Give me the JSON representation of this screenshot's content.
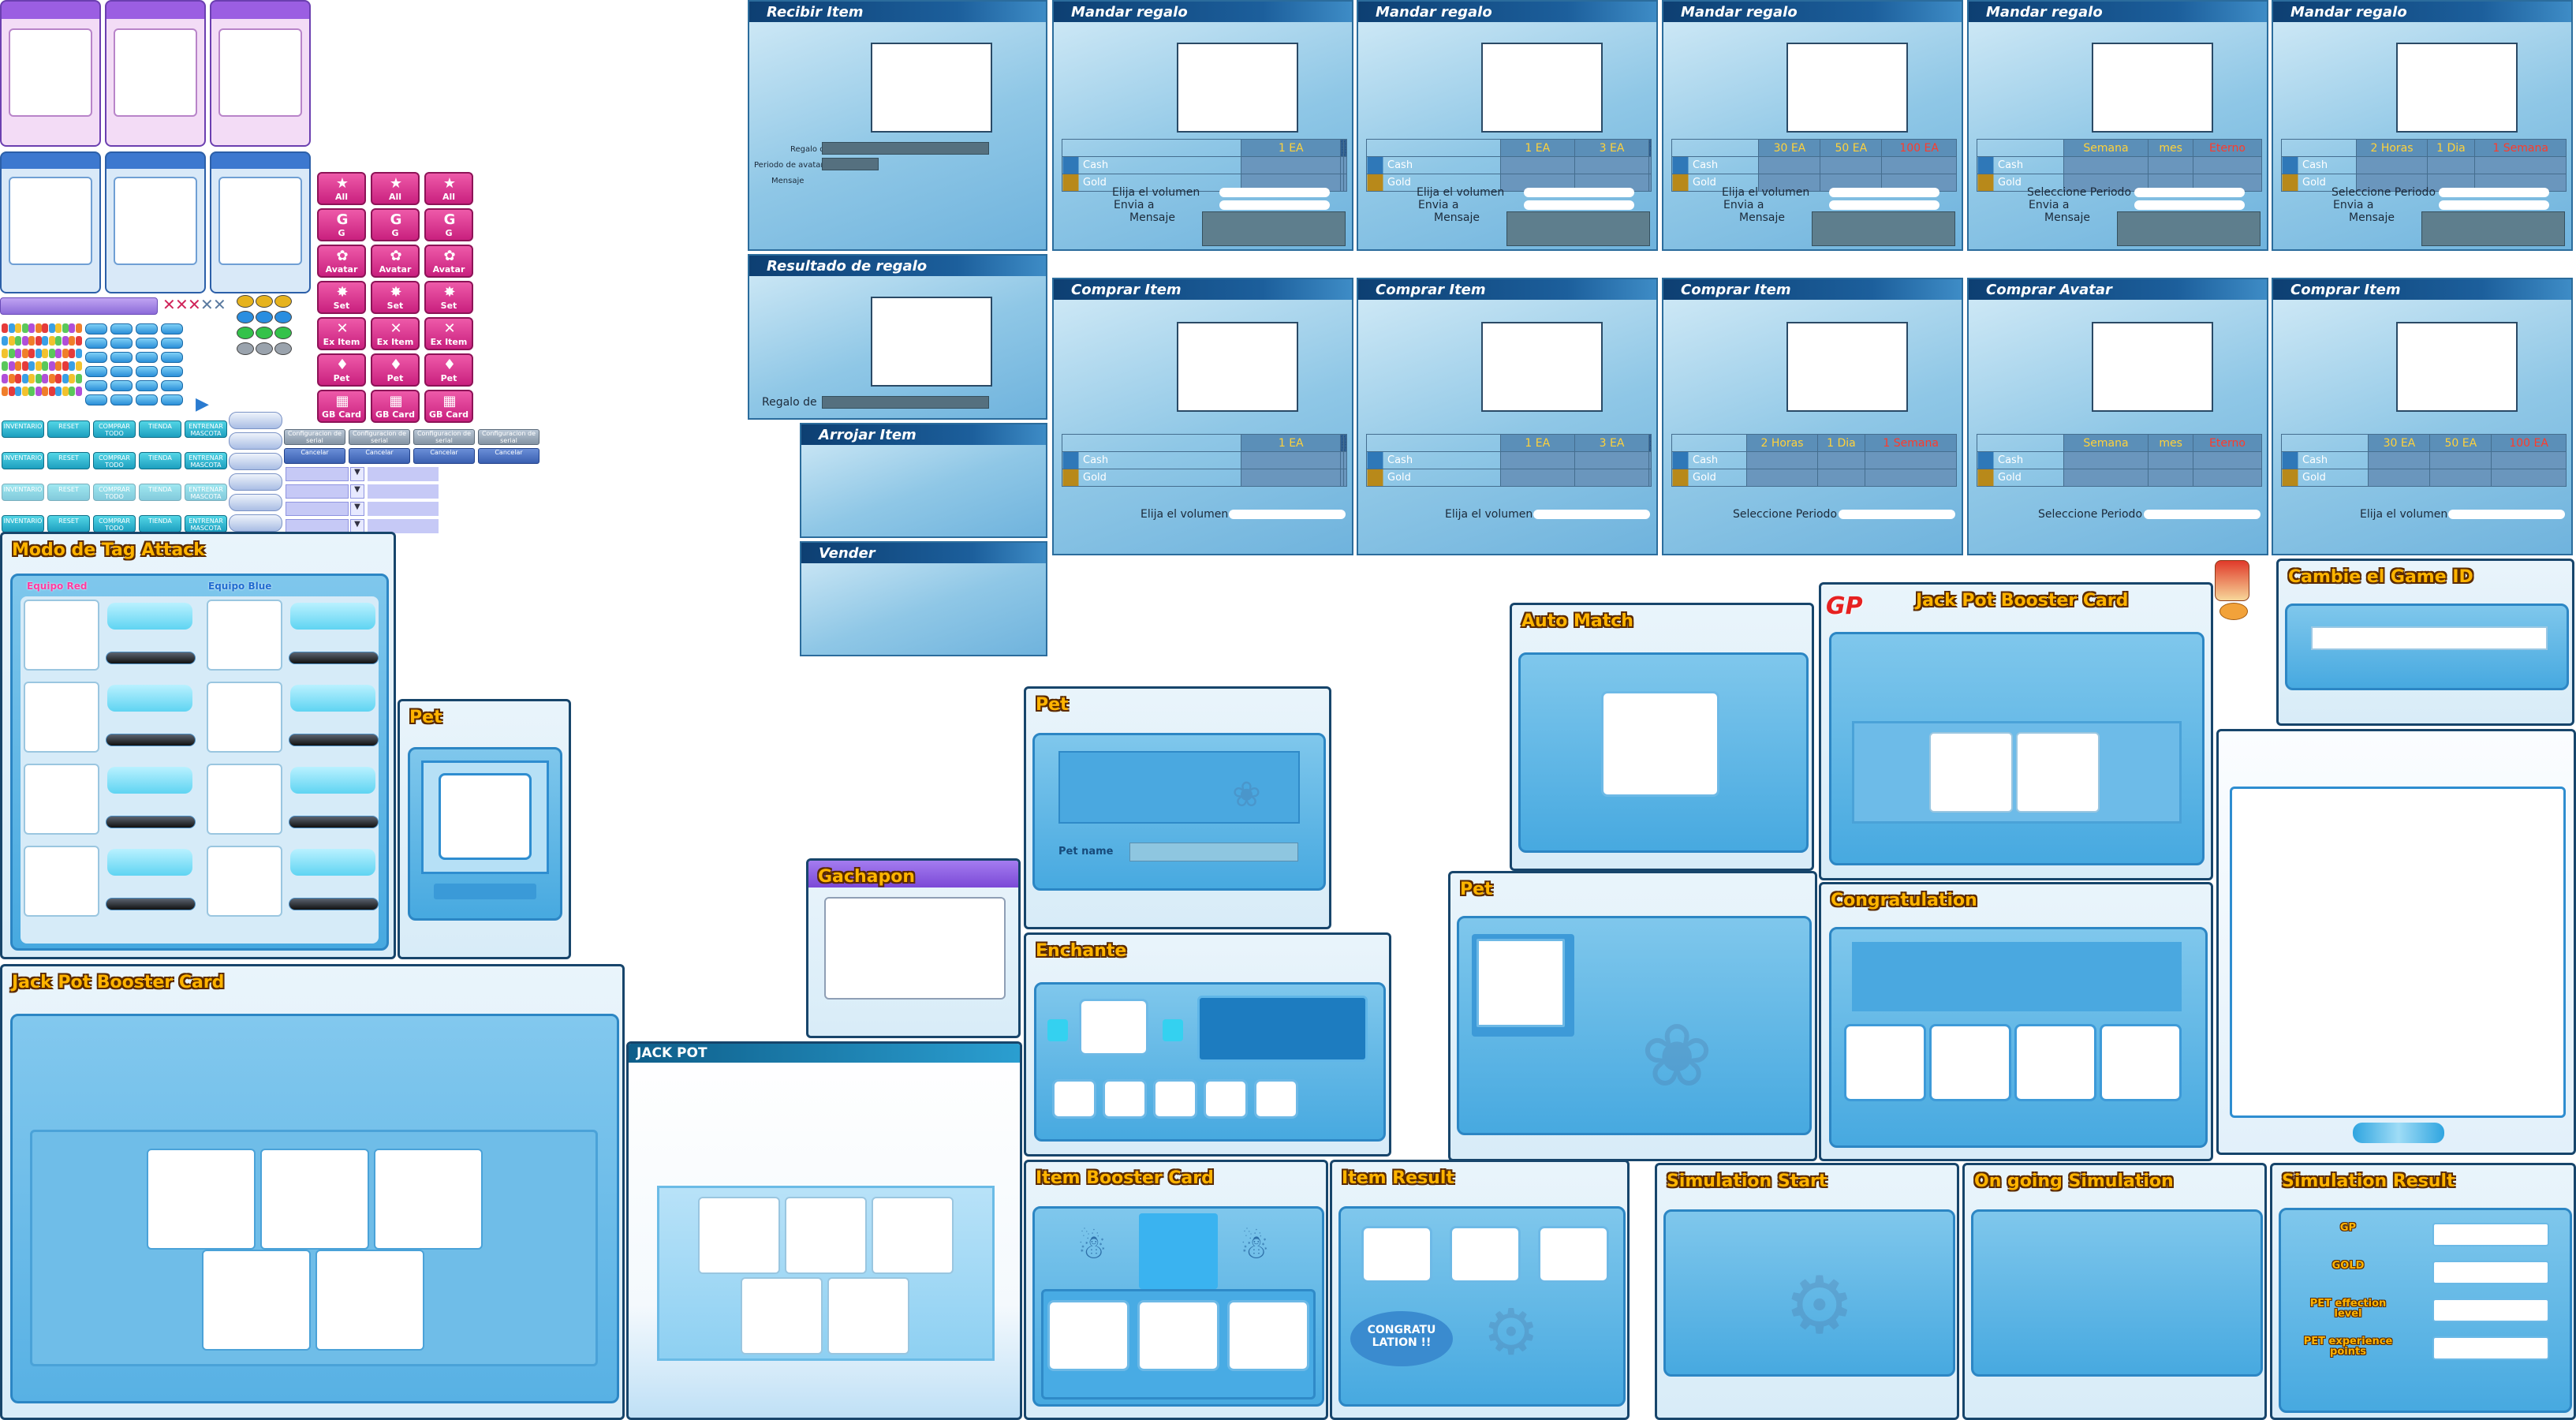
{
  "sprite": {
    "pink_buttons": [
      "All",
      "All",
      "All",
      "G",
      "G",
      "G",
      "Avatar",
      "Avatar",
      "Avatar",
      "Set",
      "Set",
      "Set",
      "Ex Item",
      "Ex Item",
      "Ex Item",
      "Pet",
      "Pet",
      "Pet",
      "GB Card",
      "GB Card",
      "GB Card"
    ],
    "tab_buttons": [
      "INVENTARIO",
      "RESET",
      "COMPRAR TODO",
      "TIENDA",
      "ENTRENAR MASCOTA"
    ],
    "gray_buttons": [
      "Configuracion de serial",
      "Cancelar"
    ],
    "colors": {
      "pink": "#d3308a",
      "blue": "#4aa7df",
      "purple": "#8b56d8"
    }
  },
  "gift_dialogs": [
    {
      "title": "Recibir Item",
      "labels": [
        "Regalo de",
        "Periodo de avatar",
        "Mensaje"
      ]
    },
    {
      "title": "Resultado de regalo",
      "labels": [
        "Regalo de"
      ]
    },
    {
      "title": "Arrojar Item"
    },
    {
      "title": "Vender"
    }
  ],
  "mandar": [
    {
      "title": "Mandar regalo",
      "cols": [
        "1 EA",
        "",
        ""
      ],
      "x": [
        false,
        true,
        true
      ],
      "red": [
        false,
        false,
        false
      ],
      "rows": [
        "Elija el volumen",
        "Envia a",
        "Mensaje"
      ]
    },
    {
      "title": "Mandar regalo",
      "cols": [
        "1 EA",
        "3 EA",
        ""
      ],
      "x": [
        false,
        false,
        true
      ],
      "red": [
        false,
        false,
        false
      ],
      "rows": [
        "Elija el volumen",
        "Envia a",
        "Mensaje"
      ]
    },
    {
      "title": "Mandar regalo",
      "cols": [
        "30 EA",
        "50 EA",
        "100 EA"
      ],
      "x": [
        false,
        false,
        false
      ],
      "red": [
        false,
        false,
        true
      ],
      "rows": [
        "Elija el volumen",
        "Envia a",
        "Mensaje"
      ]
    },
    {
      "title": "Mandar regalo",
      "cols": [
        "Semana",
        "mes",
        "Eterno"
      ],
      "x": [
        false,
        false,
        false
      ],
      "red": [
        false,
        false,
        true
      ],
      "rows": [
        "Seleccione Periodo",
        "Envia a",
        "Mensaje"
      ]
    },
    {
      "title": "Mandar regalo",
      "cols": [
        "2 Horas",
        "1 Dia",
        "1 Semana"
      ],
      "x": [
        false,
        false,
        false
      ],
      "red": [
        false,
        false,
        true
      ],
      "rows": [
        "Seleccione Periodo",
        "Envia a",
        "Mensaje"
      ]
    }
  ],
  "comprar": [
    {
      "title": "Comprar Item",
      "cols": [
        "1 EA",
        "",
        ""
      ],
      "x": [
        false,
        true,
        true
      ],
      "red": [
        false,
        false,
        false
      ],
      "row": "Elija el volumen"
    },
    {
      "title": "Comprar Item",
      "cols": [
        "1 EA",
        "3 EA",
        ""
      ],
      "x": [
        false,
        false,
        true
      ],
      "red": [
        false,
        false,
        false
      ],
      "row": "Elija el volumen"
    },
    {
      "title": "Comprar Item",
      "cols": [
        "2 Horas",
        "1 Dia",
        "1 Semana"
      ],
      "x": [
        false,
        false,
        false
      ],
      "red": [
        false,
        false,
        true
      ],
      "row": "Seleccione Periodo"
    },
    {
      "title": "Comprar Avatar",
      "cols": [
        "Semana",
        "mes",
        "Eterno"
      ],
      "x": [
        false,
        false,
        false
      ],
      "red": [
        false,
        false,
        true
      ],
      "row": "Seleccione Periodo"
    },
    {
      "title": "Comprar Item",
      "cols": [
        "30 EA",
        "50 EA",
        "100 EA"
      ],
      "x": [
        false,
        false,
        false
      ],
      "red": [
        false,
        false,
        true
      ],
      "row": "Elija el volumen"
    }
  ],
  "currency": {
    "cash": "Cash",
    "gold": "Gold"
  },
  "tag_attack": {
    "title": "Modo de Tag Attack",
    "team_red": "Equipo Red",
    "team_blue": "Equipo Blue"
  },
  "panels": {
    "pet_small": "Pet",
    "jackpot_booster": "Jack Pot Booster Card",
    "jackpot": "JACK POT",
    "gachapon": "Gachapon",
    "pet_name_panel": "Pet",
    "pet_name_label": "Pet name",
    "enchante": "Enchante",
    "item_booster": "Item Booster Card",
    "item_result": "Item Result",
    "congratulation_badge": "CONGRATU LATION !!",
    "auto_match": "Auto Match",
    "pet_large": "Pet",
    "gp_logo": "GP",
    "jackpot_booster2": "Jack Pot Booster Card",
    "congratulation": "Congratulation",
    "cambie_id": "Cambie el Game ID",
    "sim_start": "Simulation Start",
    "sim_going": "On going Simulation",
    "sim_result": "Simulation Result",
    "sim_labels": [
      "GP",
      "GOLD",
      "PET effection level",
      "PET experience points"
    ]
  }
}
